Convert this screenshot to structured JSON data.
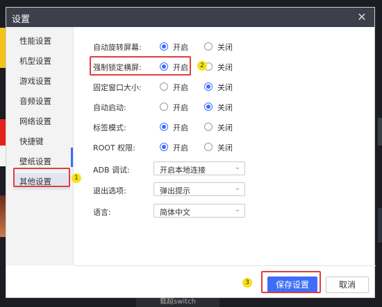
{
  "dialog": {
    "title": "设置",
    "close_glyph": "✕"
  },
  "sidebar": {
    "items": [
      {
        "label": "性能设置"
      },
      {
        "label": "机型设置"
      },
      {
        "label": "游戏设置"
      },
      {
        "label": "音频设置"
      },
      {
        "label": "网络设置"
      },
      {
        "label": "快捷键"
      },
      {
        "label": "壁纸设置"
      },
      {
        "label": "其他设置",
        "active": true
      }
    ]
  },
  "settings": {
    "rows": [
      {
        "label": "自动旋转屏幕:",
        "options": [
          "开启",
          "关闭"
        ],
        "selected": 0
      },
      {
        "label": "强制锁定横屏:",
        "options": [
          "开启",
          "关闭"
        ],
        "selected": 0
      },
      {
        "label": "固定窗口大小:",
        "options": [
          "开启",
          "关闭"
        ],
        "selected": 1
      },
      {
        "label": "自动启动:",
        "options": [
          "开启",
          "关闭"
        ],
        "selected": 1
      },
      {
        "label": "标签模式:",
        "options": [
          "开启",
          "关闭"
        ],
        "selected": 0
      },
      {
        "label": "ROOT 权限:",
        "options": [
          "开启",
          "关闭"
        ],
        "selected": 0
      }
    ],
    "selects": [
      {
        "label": "ADB 调试:",
        "value": "开启本地连接"
      },
      {
        "label": "退出选项:",
        "value": "弹出提示"
      },
      {
        "label": "语言:",
        "value": "简体中文"
      }
    ]
  },
  "footer": {
    "save_label": "保存设置",
    "cancel_label": "取消"
  },
  "annotations": {
    "badge1": "1",
    "badge2": "2",
    "badge3": "3"
  },
  "background": {
    "bottom_bar_text": "载超switch"
  },
  "colors": {
    "accent": "#3f6df7",
    "titlebar": "#3d404a",
    "highlight_box": "#e03c3c",
    "badge": "#f7e11a"
  }
}
